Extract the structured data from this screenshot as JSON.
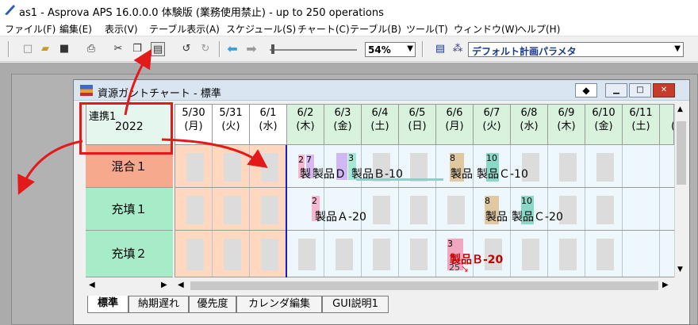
{
  "app": {
    "title": "as1 - Asprova APS 16.0.0.0 体験版 (業務使用禁止)  - up to 250 operations"
  },
  "menu": [
    "ファイル(F)",
    "編集(E)",
    "表示(V)",
    "テーブル表示(A)",
    "スケジュール(S)",
    "チャート(C)",
    "テーブル(B)",
    "ツール(T)",
    "ウィンドウ(W)",
    "ヘルプ(H)"
  ],
  "toolbar": {
    "zoom_value": "54%",
    "param_select": "デフォルト計画パラメタ"
  },
  "gantt": {
    "window_title": "資源ガントチャート - 標準",
    "corner_label": "連携1",
    "corner_year": "2022",
    "dates": [
      {
        "date": "5/30",
        "day": "(月)"
      },
      {
        "date": "5/31",
        "day": "(火)"
      },
      {
        "date": "6/1",
        "day": "(水)"
      },
      {
        "date": "6/2",
        "day": "(木)"
      },
      {
        "date": "6/3",
        "day": "(金)"
      },
      {
        "date": "6/4",
        "day": "(土)"
      },
      {
        "date": "6/5",
        "day": "(日)"
      },
      {
        "date": "6/6",
        "day": "(月)"
      },
      {
        "date": "6/7",
        "day": "(火)"
      },
      {
        "date": "6/8",
        "day": "(水)"
      },
      {
        "date": "6/9",
        "day": "(木)"
      },
      {
        "date": "6/10",
        "day": "(金)"
      },
      {
        "date": "6/11",
        "day": "(土)"
      },
      {
        "date": "6/",
        "day": "(日"
      }
    ],
    "resources": [
      "混合１",
      "充填１",
      "充填２"
    ],
    "ops": {
      "row1": {
        "n1": "2",
        "n2": "7",
        "n3": "3",
        "n4": "8",
        "n5": "10",
        "l1": "製",
        "l2": "製品Ｄ",
        "l3": "製品Ｂ-10",
        "l4": "製品",
        "l5": "製品Ｃ-10"
      },
      "row2": {
        "n1": "2",
        "n2": "8",
        "n3": "10",
        "l1": "製品Ａ-20",
        "l2": "製品",
        "l3": "製品Ｃ-20"
      },
      "row3": {
        "n1": "3",
        "n2": "25",
        "l1": "製品Ｂ-20"
      }
    }
  },
  "tabs": [
    "標準",
    "納期遅れ",
    "優先度",
    "カレンダ編集",
    "GUI説明1"
  ],
  "colors": {
    "accent_red": "#e41a1a",
    "past_bg": "#ffd8bf",
    "future_header": "#d8f2de"
  }
}
